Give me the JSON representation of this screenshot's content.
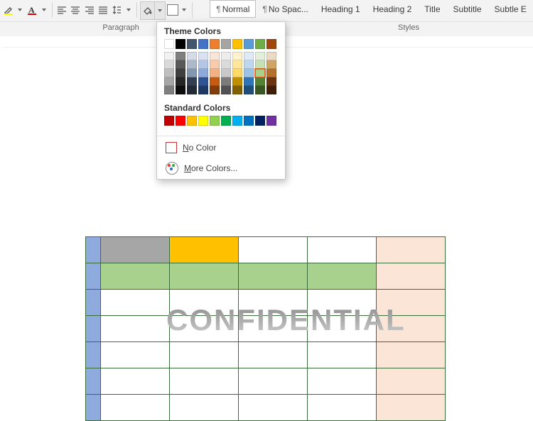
{
  "ribbon": {
    "groups": {
      "paragraph": "Paragraph",
      "styles": "Styles"
    },
    "styles": [
      {
        "label": "Normal",
        "pilcrow": true,
        "selected": true
      },
      {
        "label": "No Spac...",
        "pilcrow": true,
        "selected": false
      },
      {
        "label": "Heading 1",
        "pilcrow": false,
        "selected": false
      },
      {
        "label": "Heading 2",
        "pilcrow": false,
        "selected": false
      },
      {
        "label": "Title",
        "pilcrow": false,
        "selected": false
      },
      {
        "label": "Subtitle",
        "pilcrow": false,
        "selected": false
      },
      {
        "label": "Subtle E",
        "pilcrow": false,
        "selected": false
      }
    ]
  },
  "shading_dropdown": {
    "theme_label": "Theme Colors",
    "theme_row": [
      "#ffffff",
      "#000000",
      "#44546a",
      "#4472c4",
      "#ed7d31",
      "#a5a5a5",
      "#ffc000",
      "#5b9bd5",
      "#70ad47",
      "#9e480e"
    ],
    "shade_cols": [
      [
        "#f2f2f2",
        "#d9d9d9",
        "#bfbfbf",
        "#a6a6a6",
        "#7f7f7f"
      ],
      [
        "#7f7f7f",
        "#595959",
        "#404040",
        "#262626",
        "#0d0d0d"
      ],
      [
        "#d6dce5",
        "#adb9ca",
        "#8497b0",
        "#333f50",
        "#222a35"
      ],
      [
        "#d9e2f3",
        "#b4c6e7",
        "#8eaadb",
        "#2f5496",
        "#1f3864"
      ],
      [
        "#fbe5d6",
        "#f7cbac",
        "#f4b183",
        "#c55a11",
        "#833c0c"
      ],
      [
        "#ededed",
        "#dbdbdb",
        "#c9c9c9",
        "#7b7b7b",
        "#525252"
      ],
      [
        "#fff2cc",
        "#ffe699",
        "#ffd966",
        "#bf8f00",
        "#806000"
      ],
      [
        "#deebf7",
        "#bdd7ee",
        "#9cc3e6",
        "#2e75b6",
        "#1f4e79"
      ],
      [
        "#e2efda",
        "#c5e0b4",
        "#a9d18e",
        "#548235",
        "#385723"
      ],
      [
        "#ecd9c6",
        "#d0a465",
        "#b5702b",
        "#6b3410",
        "#3f1e09"
      ]
    ],
    "highlight": {
      "col": 8,
      "row": 2
    },
    "standard_label": "Standard Colors",
    "standard_row": [
      "#c00000",
      "#ff0000",
      "#ffc000",
      "#ffff00",
      "#92d050",
      "#00b050",
      "#00b0f0",
      "#0070c0",
      "#002060",
      "#7030a0"
    ],
    "no_color": "No Color",
    "more_colors": "More Colors..."
  },
  "document": {
    "cells": [
      [
        {
          "bg": "#8faadc"
        },
        {
          "bg": "#a6a6a6"
        },
        {
          "bg": "#ffc000"
        },
        {
          "bg": "#ffffff"
        },
        {
          "bg": "#ffffff"
        },
        {
          "bg": "#fbe5d6"
        }
      ],
      [
        {
          "bg": "#8faadc"
        },
        {
          "bg": "#a9d18e"
        },
        {
          "bg": "#a9d18e"
        },
        {
          "bg": "#a9d18e"
        },
        {
          "bg": "#a9d18e"
        },
        {
          "bg": "#fbe5d6"
        }
      ],
      [
        {
          "bg": "#8faadc"
        },
        {
          "bg": "#ffffff"
        },
        {
          "bg": "#ffffff"
        },
        {
          "bg": "#ffffff"
        },
        {
          "bg": "#ffffff"
        },
        {
          "bg": "#fbe5d6"
        }
      ],
      [
        {
          "bg": "#8faadc"
        },
        {
          "bg": "#ffffff"
        },
        {
          "bg": "#ffffff"
        },
        {
          "bg": "#ffffff"
        },
        {
          "bg": "#ffffff"
        },
        {
          "bg": "#fbe5d6"
        }
      ],
      [
        {
          "bg": "#8faadc"
        },
        {
          "bg": "#ffffff"
        },
        {
          "bg": "#ffffff"
        },
        {
          "bg": "#ffffff"
        },
        {
          "bg": "#ffffff"
        },
        {
          "bg": "#fbe5d6"
        }
      ],
      [
        {
          "bg": "#8faadc"
        },
        {
          "bg": "#ffffff"
        },
        {
          "bg": "#ffffff"
        },
        {
          "bg": "#ffffff"
        },
        {
          "bg": "#ffffff"
        },
        {
          "bg": "#fbe5d6"
        }
      ],
      [
        {
          "bg": "#8faadc"
        },
        {
          "bg": "#ffffff"
        },
        {
          "bg": "#ffffff"
        },
        {
          "bg": "#ffffff"
        },
        {
          "bg": "#ffffff"
        },
        {
          "bg": "#fbe5d6"
        }
      ]
    ],
    "watermark": "CONFIDENTIAL"
  }
}
